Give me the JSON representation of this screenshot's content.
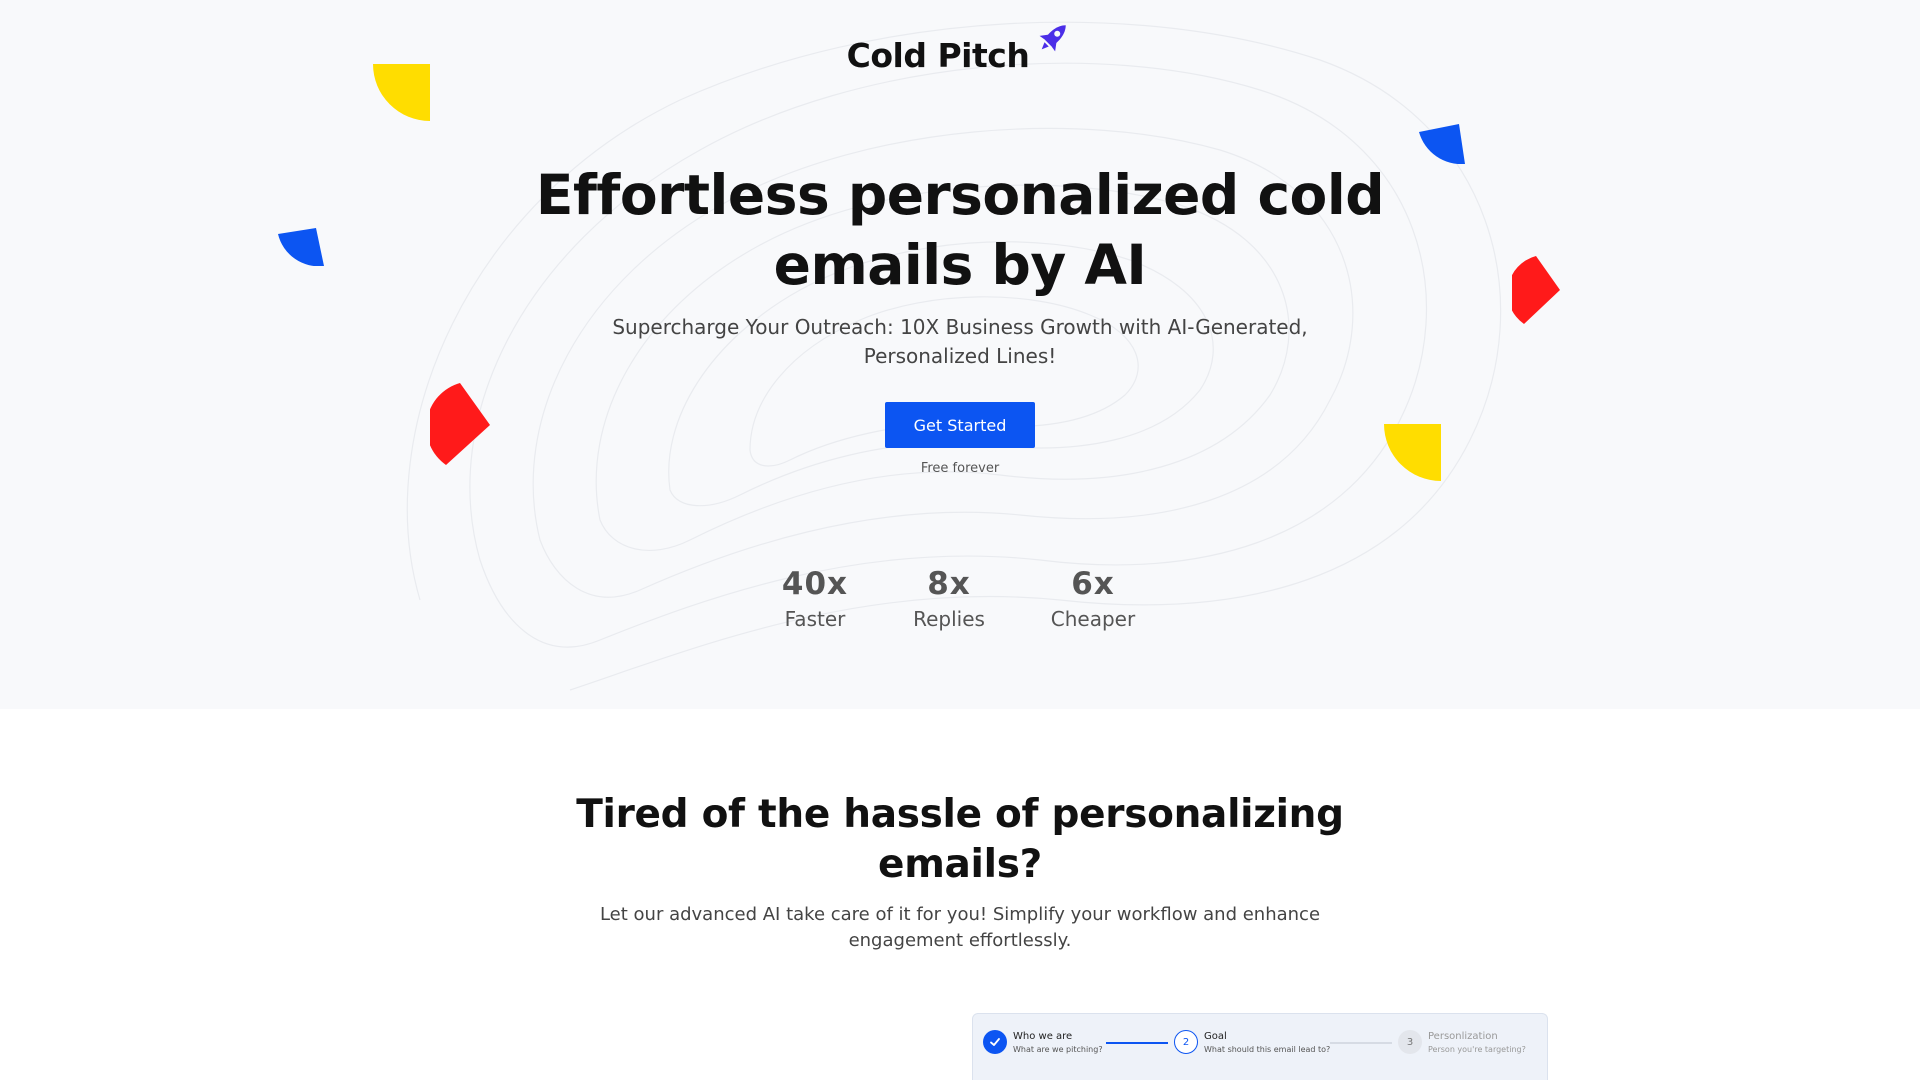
{
  "brand": {
    "name": "Cold Pitch",
    "icon": "rocket-icon",
    "icon_color": "#4b2ee8"
  },
  "hero": {
    "title": "Effortless personalized cold emails by AI",
    "subtitle": "Supercharge Your Outreach: 10X Business Growth with AI-Generated, Personalized Lines!",
    "cta_label": "Get Started",
    "cta_note": "Free forever",
    "stats": [
      {
        "value": "40x",
        "label": "Faster"
      },
      {
        "value": "8x",
        "label": "Replies"
      },
      {
        "value": "6x",
        "label": "Cheaper"
      }
    ]
  },
  "section2": {
    "title": "Tired of the hassle of personalizing emails?",
    "subtitle": "Let our advanced AI take care of it for you! Simplify your workflow and enhance engagement effortlessly."
  },
  "preview": {
    "steps": [
      {
        "number": "",
        "title": "Who we are",
        "desc": "What are we pitching?",
        "state": "done"
      },
      {
        "number": "2",
        "title": "Goal",
        "desc": "What should this email lead to?",
        "state": "active"
      },
      {
        "number": "3",
        "title": "Personlization",
        "desc": "Person you're targeting?",
        "state": "todo"
      }
    ]
  },
  "colors": {
    "accent": "#0c55f2",
    "shape_yellow": "#ffdd00",
    "shape_blue": "#0c55f2",
    "shape_red": "#ff1a1a",
    "hero_bg": "#f8f9fb"
  }
}
